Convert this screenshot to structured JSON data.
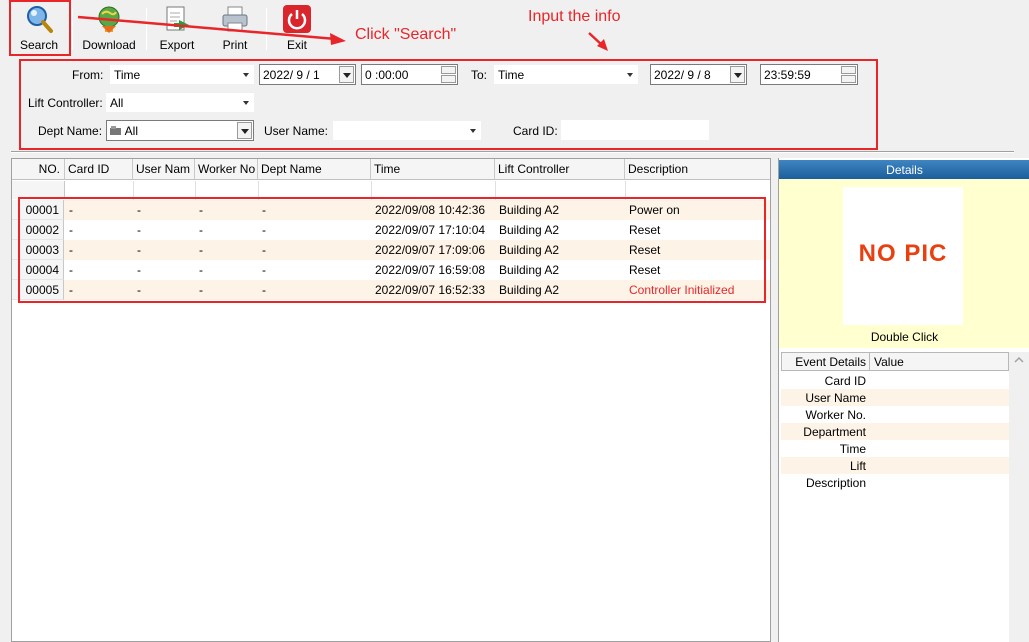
{
  "toolbar": {
    "search": "Search",
    "download": "Download",
    "export": "Export",
    "print": "Print",
    "exit": "Exit"
  },
  "filters": {
    "from_label": "From:",
    "from_mode": "Time",
    "from_date": "2022/ 9 / 1",
    "from_time": "0 :00:00",
    "to_label": "To:",
    "to_mode": "Time",
    "to_date": "2022/ 9 / 8",
    "to_time": "23:59:59",
    "lift_label": "Lift Controller:",
    "lift_value": "All",
    "dept_label": "Dept Name:",
    "dept_value": "All",
    "user_label": "User Name:",
    "user_value": "",
    "card_label": "Card ID:",
    "card_value": ""
  },
  "grid": {
    "columns": [
      "NO.",
      "Card ID",
      "User Nam",
      "Worker No",
      "Dept Name",
      "Time",
      "Lift Controller",
      "Description"
    ],
    "rows": [
      {
        "no": "00001",
        "card": "-",
        "user": "-",
        "worker": "-",
        "dept": "-",
        "time": "2022/09/08 10:42:36",
        "lift": "Building A2",
        "desc": "Power on",
        "desc_color": "#000000"
      },
      {
        "no": "00002",
        "card": "-",
        "user": "-",
        "worker": "-",
        "dept": "-",
        "time": "2022/09/07 17:10:04",
        "lift": "Building A2",
        "desc": "Reset",
        "desc_color": "#000000"
      },
      {
        "no": "00003",
        "card": "-",
        "user": "-",
        "worker": "-",
        "dept": "-",
        "time": "2022/09/07 17:09:06",
        "lift": "Building A2",
        "desc": "Reset",
        "desc_color": "#000000"
      },
      {
        "no": "00004",
        "card": "-",
        "user": "-",
        "worker": "-",
        "dept": "-",
        "time": "2022/09/07 16:59:08",
        "lift": "Building A2",
        "desc": "Reset",
        "desc_color": "#000000"
      },
      {
        "no": "00005",
        "card": "-",
        "user": "-",
        "worker": "-",
        "dept": "-",
        "time": "2022/09/07 16:52:33",
        "lift": "Building A2",
        "desc": "Controller Initialized",
        "desc_color": "#e8262a"
      }
    ]
  },
  "details": {
    "title": "Details",
    "no_pic": "NO PIC",
    "double_click": "Double Click",
    "head_key": "Event Details",
    "head_value": "Value",
    "fields": [
      "Card ID",
      "User Name",
      "Worker No.",
      "Department",
      "Time",
      "Lift",
      "Description"
    ]
  },
  "annotations": {
    "click_search": "Click \"Search\"",
    "input_info": "Input the info",
    "color": "#e8262a"
  }
}
